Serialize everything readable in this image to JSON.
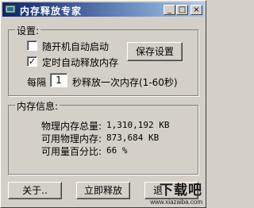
{
  "window": {
    "title": "内存释放专家",
    "icon": "chip-icon",
    "controls": [
      "_",
      "□",
      "×"
    ]
  },
  "settings": {
    "legend": "设置:",
    "autostart": {
      "label": "随开机自动启动",
      "checked": false
    },
    "auto_release": {
      "label": "定时自动释放内存",
      "checked": true
    },
    "save_button": "保存设置",
    "interval_prefix": "每隔",
    "interval_value": "1",
    "interval_suffix": "秒释放一次内存(1-60秒)"
  },
  "memory": {
    "legend": "内存信息:",
    "total_label": "物理内存总量:",
    "total_value": "1,310,192 KB",
    "available_label": "可用物理内存:",
    "available_value": "873,684 KB",
    "percent_label": "可用量百分比:",
    "percent_value": "66 %"
  },
  "buttons": {
    "about": "关于..",
    "release_now": "立即释放",
    "exit": "退"
  },
  "watermark": {
    "text": "下载吧",
    "url": "www.xiazaiba.com"
  }
}
